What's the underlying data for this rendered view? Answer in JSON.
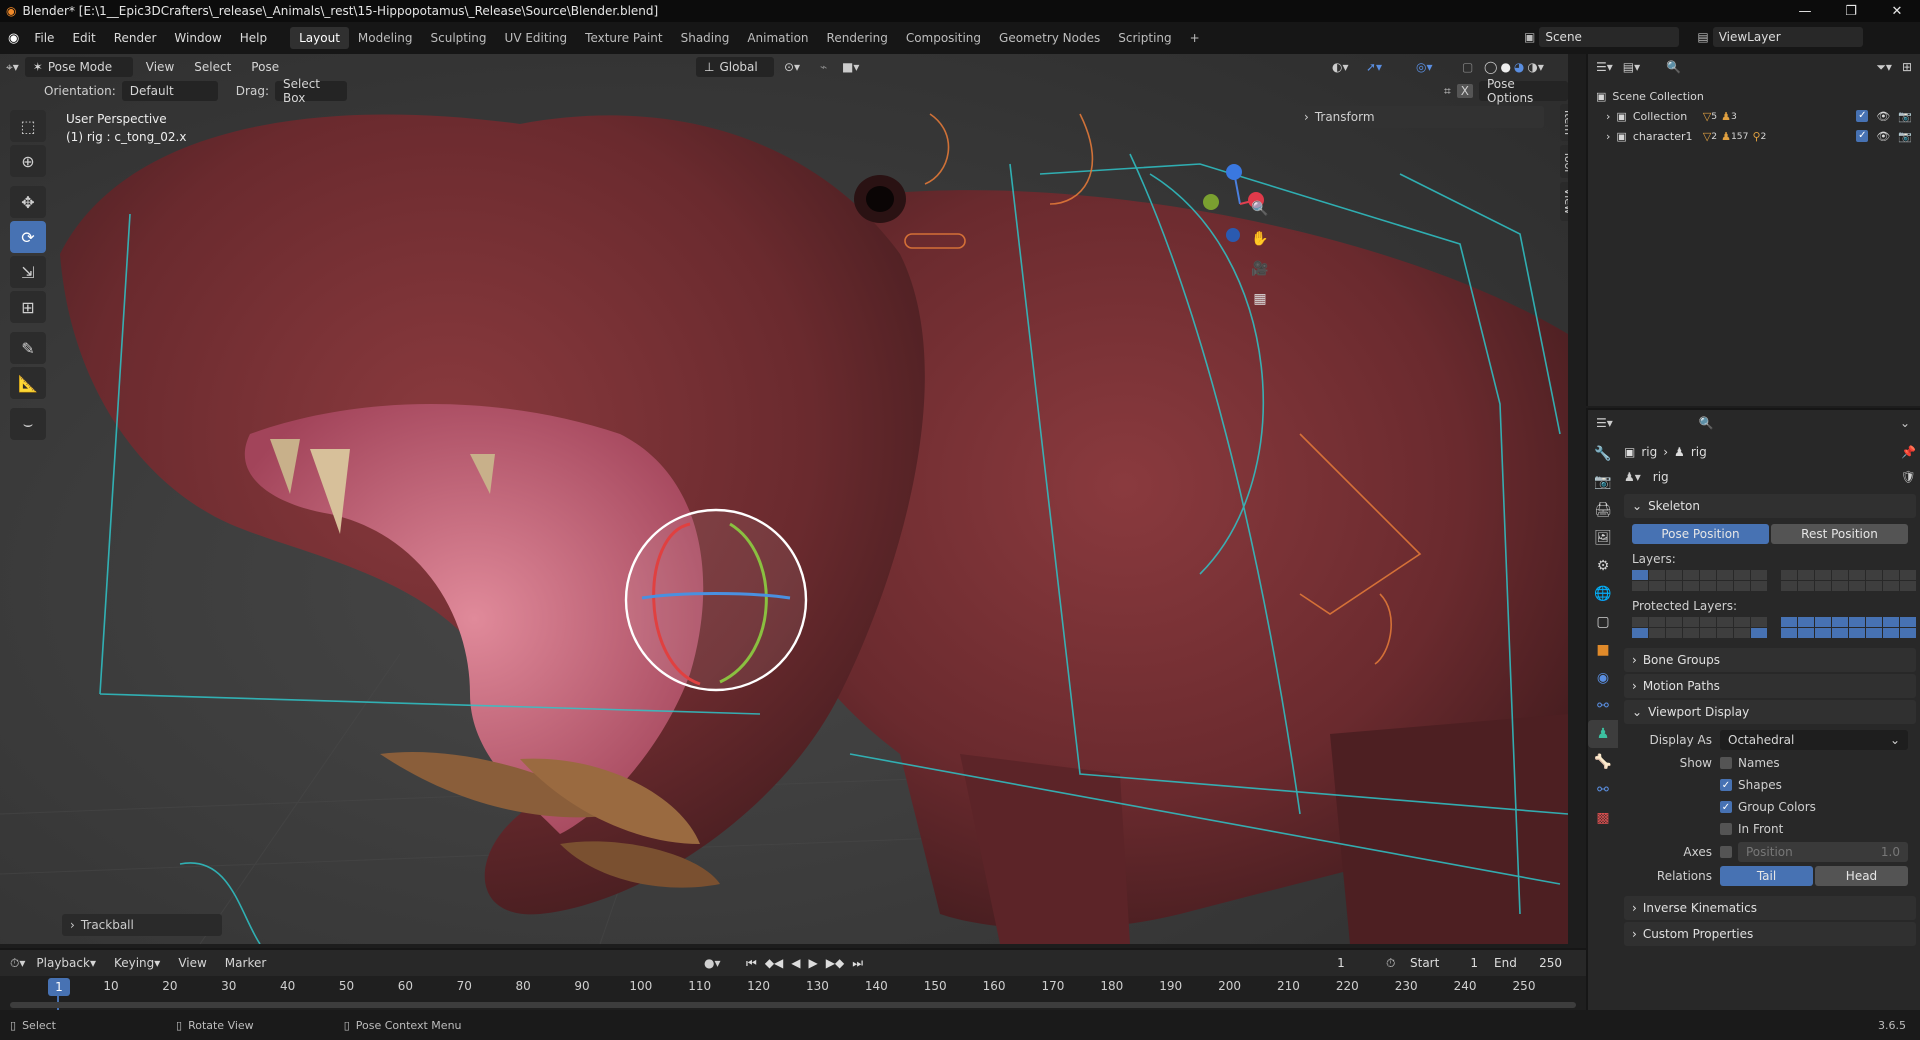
{
  "window": {
    "title": "Blender* [E:\\1__Epic3DCrafters\\_release\\_Animals\\_rest\\15-Hippopotamus\\_Release\\Source\\Blender.blend]",
    "controls": [
      "—",
      "❐",
      "✕"
    ]
  },
  "menu": {
    "items": [
      "File",
      "Edit",
      "Render",
      "Window",
      "Help"
    ],
    "workspaces": [
      "Layout",
      "Modeling",
      "Sculpting",
      "UV Editing",
      "Texture Paint",
      "Shading",
      "Animation",
      "Rendering",
      "Compositing",
      "Geometry Nodes",
      "Scripting"
    ],
    "active_workspace": "Layout",
    "add_tab": "+",
    "scene": "Scene",
    "view_layer": "ViewLayer"
  },
  "viewport": {
    "mode": "Pose Mode",
    "menus": [
      "View",
      "Select",
      "Pose"
    ],
    "transform_orientation": "Global",
    "orientation_label": "Orientation:",
    "orientation_value": "Default",
    "drag_label": "Drag:",
    "drag_value": "Select Box",
    "pose_options": "Pose Options",
    "perspective": "User Perspective",
    "active_info": "(1) rig : c_tong_02.x",
    "transform_panel": "Transform",
    "side_tabs": [
      "Item",
      "Tool",
      "View"
    ],
    "last_operator": "Trackball",
    "gizmo_axes": [
      "Z",
      "X"
    ],
    "tools": [
      "select-box-icon",
      "cursor-icon",
      "move-icon",
      "rotate-icon",
      "scale-icon",
      "transform-icon",
      "annotate-icon",
      "measure-icon",
      "bone-envelope-icon"
    ],
    "active_tool": "rotate-icon"
  },
  "outliner": {
    "root": "Scene Collection",
    "items": [
      {
        "name": "Collection",
        "badges": [
          "5",
          "3"
        ]
      },
      {
        "name": "character1",
        "badges": [
          "2",
          "157",
          "2"
        ]
      }
    ]
  },
  "properties": {
    "breadcrumb": [
      "rig",
      "rig"
    ],
    "data_name": "rig",
    "skeleton": {
      "title": "Skeleton",
      "pose_position": "Pose Position",
      "rest_position": "Rest Position",
      "layers_label": "Layers:",
      "protected_label": "Protected Layers:"
    },
    "collapsed_panels": [
      "Bone Groups",
      "Motion Paths"
    ],
    "viewport_display": {
      "title": "Viewport Display",
      "display_as_label": "Display As",
      "display_as_value": "Octahedral",
      "show_label": "Show",
      "options": [
        {
          "label": "Names",
          "checked": false
        },
        {
          "label": "Shapes",
          "checked": true
        },
        {
          "label": "Group Colors",
          "checked": true
        },
        {
          "label": "In Front",
          "checked": false
        }
      ],
      "axes_label": "Axes",
      "axes_position": "Position",
      "axes_value": "1.0",
      "relations_label": "Relations",
      "relations_tail": "Tail",
      "relations_head": "Head"
    },
    "more_panels": [
      "Inverse Kinematics",
      "Custom Properties"
    ]
  },
  "timeline": {
    "menus": [
      "Playback",
      "Keying",
      "View",
      "Marker"
    ],
    "current_frame": "1",
    "start_label": "Start",
    "start": "1",
    "end_label": "End",
    "end": "250",
    "ticks": [
      "1",
      "10",
      "20",
      "30",
      "40",
      "50",
      "60",
      "70",
      "80",
      "90",
      "100",
      "110",
      "120",
      "130",
      "140",
      "150",
      "160",
      "170",
      "180",
      "190",
      "200",
      "210",
      "220",
      "230",
      "240",
      "250"
    ]
  },
  "status": {
    "items": [
      "Select",
      "Rotate View",
      "Pose Context Menu"
    ],
    "version": "3.6.5"
  }
}
